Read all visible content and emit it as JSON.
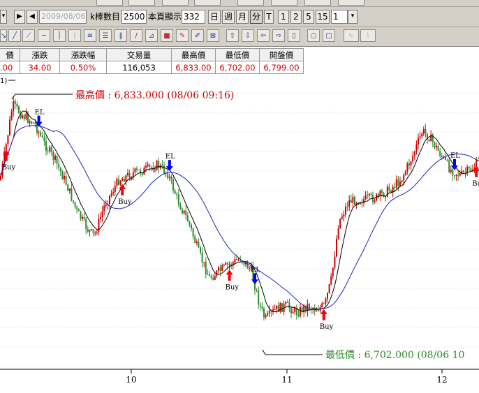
{
  "toolbar": {
    "date": "2009/08/06",
    "k_count_label": "k棒數目",
    "k_count_value": "2500",
    "page_show_label": "本頁顯示",
    "page_show_value": "332",
    "period_day": "日",
    "period_week": "週",
    "period_month": "月",
    "period_minute": "分",
    "period_tick": "T",
    "n1": "1",
    "n2": "2",
    "n5": "5",
    "n15": "15",
    "interval_value": "1"
  },
  "quote": {
    "headers": [
      "價",
      "漲跌",
      "漲跌幅",
      "交易量",
      "最高價",
      "最低價",
      "開盤價"
    ],
    "values": [
      ".00",
      "34.00",
      "0.50%",
      "116,053",
      "6,833.00",
      "6,702.00",
      "6,799.00"
    ]
  },
  "chart": {
    "indicator_label": "1)",
    "high_annotation": "最高價 : 6,833.000 (08/06 09:16)",
    "low_annotation": "最低價 : 6,702.000 (08/06 10",
    "x_ticks": [
      "10",
      "11",
      "12"
    ],
    "signals": [
      {
        "type": "Buy",
        "bar": 3
      },
      {
        "type": "EL",
        "bar": 21
      },
      {
        "type": "Buy",
        "bar": 67
      },
      {
        "type": "EL",
        "bar": 93
      },
      {
        "type": "Buy",
        "bar": 126
      },
      {
        "type": "EL",
        "bar": 140
      },
      {
        "type": "Buy",
        "bar": 178
      },
      {
        "type": "EL",
        "bar": 250
      },
      {
        "type": "Bu",
        "bar": 262
      }
    ],
    "colors": {
      "up": "#d00000",
      "down": "#2e8b2e",
      "ma_fast": "#000000",
      "ma_slow": "#2020c0",
      "annotation_high": "#d00000",
      "annotation_low": "#2e8b2e",
      "buy_arrow": "#ff0000",
      "exit_arrow": "#0000ff"
    }
  }
}
